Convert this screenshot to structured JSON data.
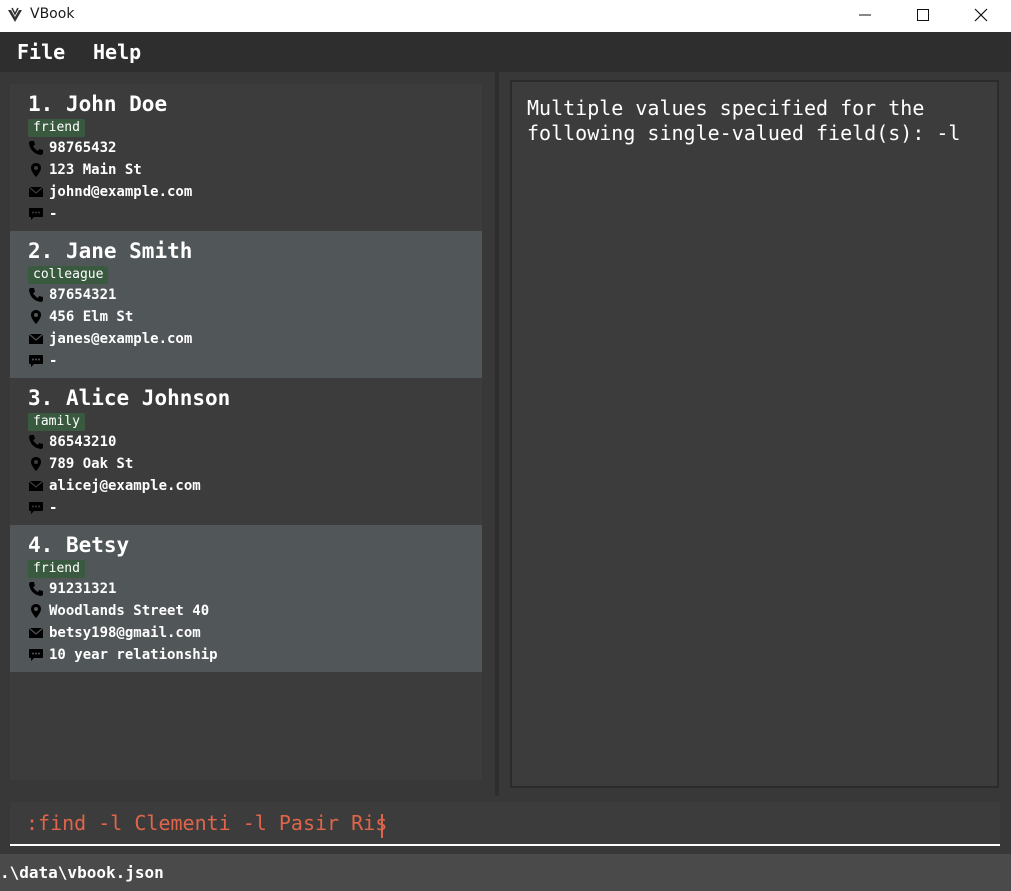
{
  "window": {
    "title": "VBook"
  },
  "menu": {
    "file": "File",
    "help": "Help"
  },
  "contacts": [
    {
      "index": "1.",
      "name": "John Doe",
      "tag": "friend",
      "phone": "98765432",
      "address": "123 Main St",
      "email": "johnd@example.com",
      "remark": "-"
    },
    {
      "index": "2.",
      "name": "Jane Smith",
      "tag": "colleague",
      "phone": "87654321",
      "address": "456 Elm St",
      "email": "janes@example.com",
      "remark": "-"
    },
    {
      "index": "3.",
      "name": "Alice Johnson",
      "tag": "family",
      "phone": "86543210",
      "address": "789 Oak St",
      "email": "alicej@example.com",
      "remark": "-"
    },
    {
      "index": "4.",
      "name": "Betsy",
      "tag": "friend",
      "phone": "91231321",
      "address": "Woodlands Street 40",
      "email": "betsy198@gmail.com",
      "remark": "10 year relationship"
    }
  ],
  "result": {
    "message": "Multiple values specified for the\nfollowing single-valued field(s): -l"
  },
  "command": {
    "value": ":find -l Clementi -l Pasir Ris"
  },
  "status": {
    "path": ".\\data\\vbook.json"
  },
  "colors": {
    "tag_bg": "#3a5a40",
    "command_text": "#e0654a",
    "card_alt": "#515658"
  }
}
